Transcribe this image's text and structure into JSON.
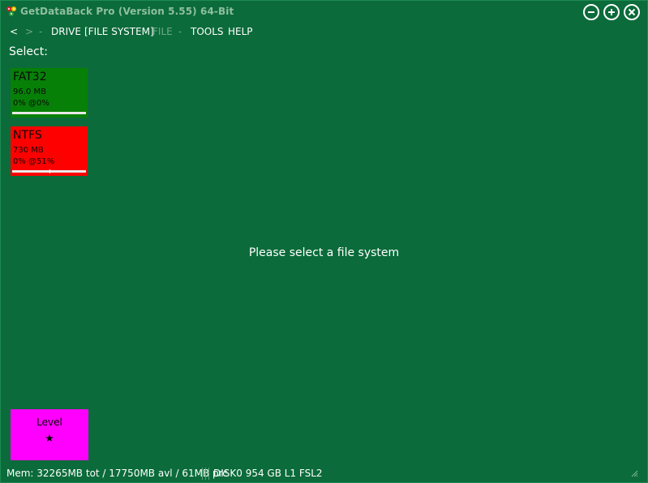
{
  "window": {
    "title": "GetDataBack Pro (Version 5.55) 64-Bit"
  },
  "menu": {
    "back": "<",
    "forward": ">",
    "sep1": "-",
    "drive": "DRIVE",
    "file_system": "[FILE SYSTEM]",
    "file": "FILE",
    "sep2": "-",
    "tools": "TOOLS",
    "help": "HELP"
  },
  "select_label": "Select:",
  "file_systems": [
    {
      "name": "FAT32",
      "size": "96.0 MB",
      "progress_text": "0% @0%",
      "progress": 0,
      "position": 0,
      "color": "#078008"
    },
    {
      "name": "NTFS",
      "size": "730 MB",
      "progress_text": "0% @51%",
      "progress": 0,
      "position": 0.51,
      "color": "#ff0000"
    }
  ],
  "center_message": "Please select a file system",
  "level": {
    "label": "Level",
    "stars": "★",
    "color": "#ff00ff"
  },
  "status": {
    "memory": "Mem: 32265MB tot / 17750MB avl / 61MB prc",
    "disk": "DISK0 954 GB L1 FSL2"
  },
  "colors": {
    "background": "#0b6b3a",
    "title_text": "#8fbf9f",
    "dim_menu": "#6fa987"
  },
  "icons": {
    "app": "getdataback-logo-icon",
    "minimize": "minimize-icon",
    "maximize": "maximize-icon",
    "close": "close-icon",
    "resize": "resize-grip-icon"
  }
}
